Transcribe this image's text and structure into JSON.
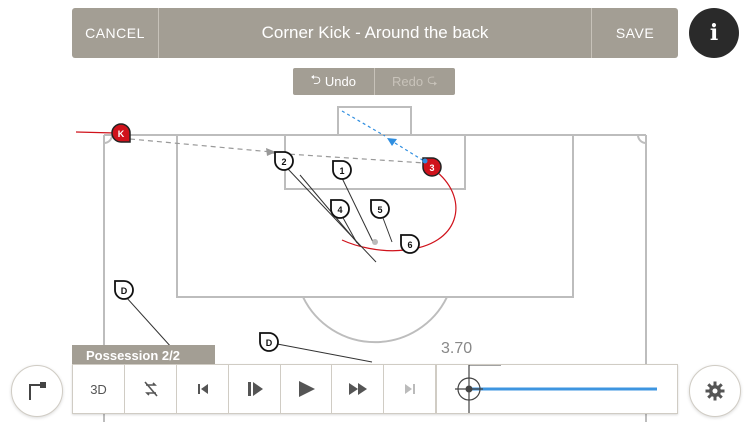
{
  "header": {
    "cancel_label": "CANCEL",
    "title": "Corner Kick - Around the back",
    "save_label": "SAVE",
    "info_label": "i"
  },
  "history": {
    "undo_label": "Undo",
    "redo_label": "Redo"
  },
  "players": {
    "kicker": "K",
    "attackers": [
      "1",
      "2",
      "3",
      "4",
      "5",
      "6"
    ],
    "defender_label": "D"
  },
  "possession": {
    "label": "Possession 2/2"
  },
  "playback": {
    "mode_3d_label": "3D",
    "time_value": "3.70",
    "progress_fraction": 1.0
  },
  "colors": {
    "toolbar": "#a39e94",
    "attacker_highlight": "#d0121b",
    "pass_blue": "#2f8ee0",
    "slider_blue": "#3d95e0",
    "pitch_lines": "#bdbdbd"
  },
  "icons": {
    "corner_flag": "corner-flag-icon",
    "undo": "undo-arrow-icon",
    "redo": "redo-arrow-icon",
    "settings": "gear-icon"
  }
}
